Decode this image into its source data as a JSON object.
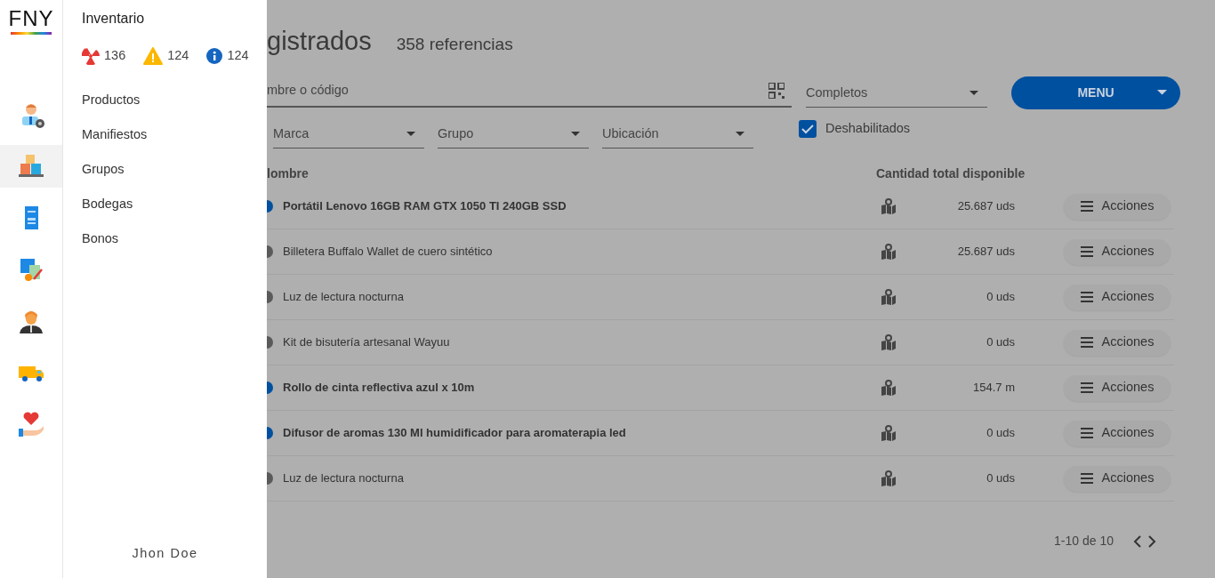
{
  "rail": {
    "logo": "FNY",
    "items": [
      {
        "selected": false
      },
      {
        "selected": true
      },
      {
        "selected": false
      },
      {
        "selected": false
      },
      {
        "selected": false
      },
      {
        "selected": false
      },
      {
        "selected": false
      }
    ]
  },
  "drawer": {
    "title": "Inventario",
    "alerts": [
      {
        "kind": "hazard",
        "count": "136"
      },
      {
        "kind": "warning",
        "count": "124"
      },
      {
        "kind": "info",
        "count": "124"
      }
    ],
    "items": [
      "Productos",
      "Manifiestos",
      "Grupos",
      "Bodegas",
      "Bonos"
    ],
    "user": "Jhon Doe"
  },
  "main": {
    "title": "gistrados",
    "subtitle": "358 referencias",
    "search": {
      "placeholder": "mbre o código"
    },
    "status_select": {
      "value": "Completos"
    },
    "menu_button": "MENU",
    "filters": [
      {
        "placeholder": "Marca"
      },
      {
        "placeholder": "Grupo"
      },
      {
        "placeholder": "Ubicación"
      }
    ],
    "disabled_filter": {
      "label": "Deshabilitados",
      "checked": true
    },
    "table": {
      "columns": [
        "lombre",
        "Cantidad total disponible"
      ],
      "rows": [
        {
          "name": "Portátil Lenovo 16GB RAM GTX 1050 TI 240GB SSD",
          "bold": true,
          "color": "#0050a0",
          "quantity": "25.687 uds",
          "action": "Acciones"
        },
        {
          "name": "Billetera Buffalo Wallet de cuero sintético",
          "bold": false,
          "color": "#5a5a5a",
          "quantity": "25.687 uds",
          "action": "Acciones"
        },
        {
          "name": "Luz de lectura nocturna",
          "bold": false,
          "color": "#5a5a5a",
          "quantity": "0 uds",
          "action": "Acciones"
        },
        {
          "name": "Kit de bisutería artesanal Wayuu",
          "bold": false,
          "color": "#5a5a5a",
          "quantity": "0 uds",
          "action": "Acciones"
        },
        {
          "name": "Rollo de cinta reflectiva azul x 10m",
          "bold": true,
          "color": "#0050a0",
          "quantity": "154.7 m",
          "action": "Acciones"
        },
        {
          "name": "Difusor de aromas 130 Ml humidificador para aromaterapia led",
          "bold": true,
          "color": "#0050a0",
          "quantity": "0 uds",
          "action": "Acciones"
        },
        {
          "name": "Luz de lectura nocturna",
          "bold": false,
          "color": "#5a5a5a",
          "quantity": "0 uds",
          "action": "Acciones"
        }
      ]
    },
    "pagination": "1-10 de 10"
  }
}
